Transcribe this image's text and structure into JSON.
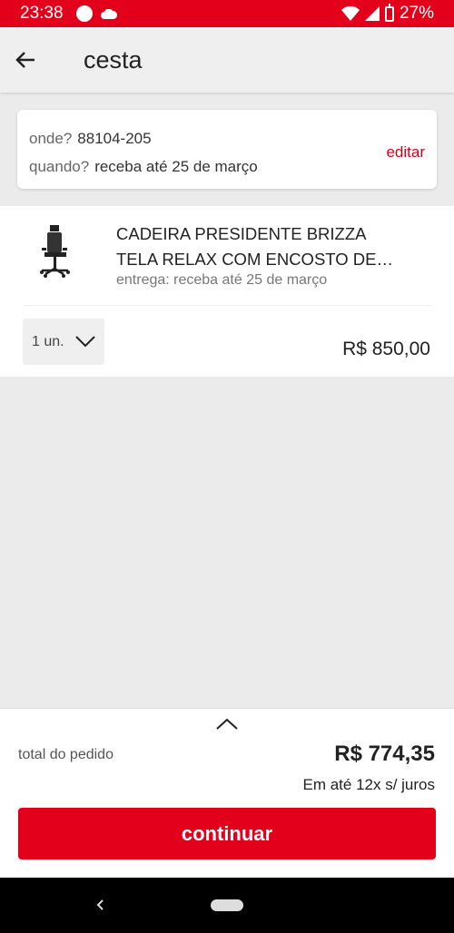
{
  "status_bar": {
    "time": "23:38",
    "battery": "27%",
    "icons": [
      "circle-icon",
      "cloud-icon",
      "wifi-icon",
      "signal-icon",
      "battery-icon"
    ]
  },
  "app_bar": {
    "title": "cesta",
    "back_icon": "arrow-left-icon"
  },
  "delivery": {
    "where_label": "onde?",
    "where_value": "88104-205",
    "when_label": "quando?",
    "when_value": "receba até 25 de março",
    "edit_label": "editar"
  },
  "item": {
    "name_line1": "CADEIRA PRESIDENTE BRIZZA",
    "name_line2": "TELA RELAX COM ENCOSTO DE…",
    "delivery_note": "entrega: receba até 25 de março",
    "quantity": "1 un.",
    "price": "R$ 850,00"
  },
  "footer": {
    "total_label": "total do pedido",
    "total_value": "R$ 774,35",
    "installments": "Em até 12x s/ juros",
    "continue_label": "continuar"
  },
  "colors": {
    "brand_red": "#e3001b",
    "link_red": "#d4001a",
    "background": "#ebebeb"
  }
}
